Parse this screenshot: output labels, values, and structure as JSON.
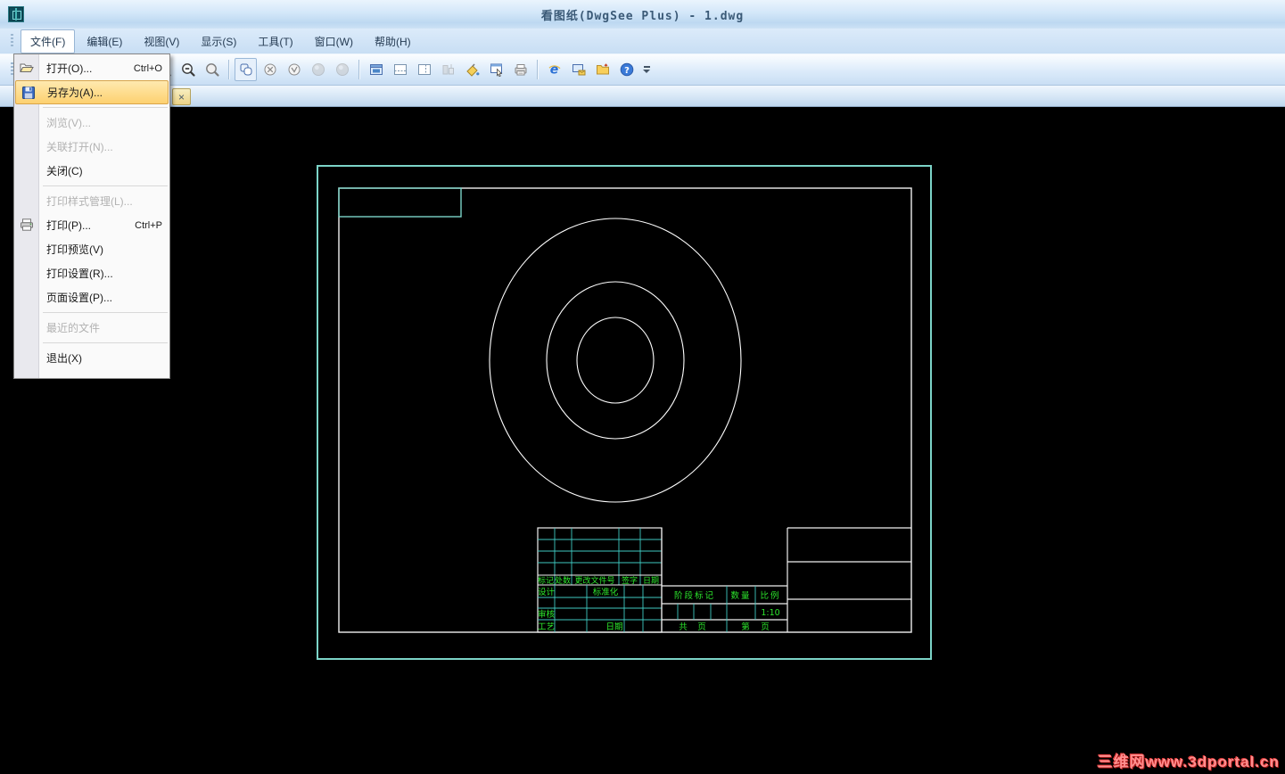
{
  "window": {
    "title": "看图纸(DwgSee Plus) - 1.dwg"
  },
  "menubar": {
    "items": [
      {
        "label": "文件(F)"
      },
      {
        "label": "编辑(E)"
      },
      {
        "label": "视图(V)"
      },
      {
        "label": "显示(S)"
      },
      {
        "label": "工具(T)"
      },
      {
        "label": "窗口(W)"
      },
      {
        "label": "帮助(H)"
      }
    ]
  },
  "toolbar": {
    "icons": [
      "document-columns",
      "image-preview",
      "pan-hand",
      "zoom-extents",
      "zoom-window",
      "zoom-in",
      "zoom-out",
      "zoom-realtime",
      "viewport-overlap",
      "circle-cross",
      "circle-check",
      "sphere-1",
      "sphere-2",
      "window-single",
      "window-horizontal-split",
      "window-vertical-split",
      "structure",
      "fill-style",
      "properties",
      "print-list",
      "internet-explorer",
      "send-mail",
      "open-folder",
      "help"
    ],
    "ie_glyph": "e",
    "help_glyph": "?"
  },
  "tabstrip": {
    "close_glyph": "×"
  },
  "file_menu": {
    "items": [
      {
        "label": "打开(O)...",
        "shortcut": "Ctrl+O"
      },
      {
        "label": "另存为(A)...",
        "shortcut": ""
      },
      {
        "label": "浏览(V)...",
        "shortcut": ""
      },
      {
        "label": "关联打开(N)...",
        "shortcut": ""
      },
      {
        "label": "关闭(C)",
        "shortcut": ""
      },
      {
        "label": "打印样式管理(L)...",
        "shortcut": ""
      },
      {
        "label": "打印(P)...",
        "shortcut": "Ctrl+P"
      },
      {
        "label": "打印预览(V)",
        "shortcut": ""
      },
      {
        "label": "打印设置(R)...",
        "shortcut": ""
      },
      {
        "label": "页面设置(P)...",
        "shortcut": ""
      },
      {
        "label": "最近的文件",
        "shortcut": ""
      },
      {
        "label": "退出(X)",
        "shortcut": ""
      }
    ]
  },
  "drawing": {
    "file": "1.dwg",
    "title_block": {
      "header": [
        "标记",
        "处数",
        "更改文件号",
        "签字",
        "日期"
      ],
      "rows": {
        "design": "设计",
        "standardize": "标准化",
        "review": "审核",
        "process": "工艺",
        "date": "日期"
      },
      "right": {
        "stage_mark": "阶段标记",
        "quantity": "数量",
        "scale_label": "比例",
        "scale_value": "1:10",
        "total": "共",
        "total_page": "页",
        "sheet": "第",
        "sheet_page": "页"
      }
    },
    "colors": {
      "frame": "#7cd4c8",
      "grid": "#3fc9c1",
      "lines": "#f0f0f0",
      "labels": "#2ce52c"
    }
  },
  "watermark": {
    "text": "三维网www.3dportal.cn"
  }
}
